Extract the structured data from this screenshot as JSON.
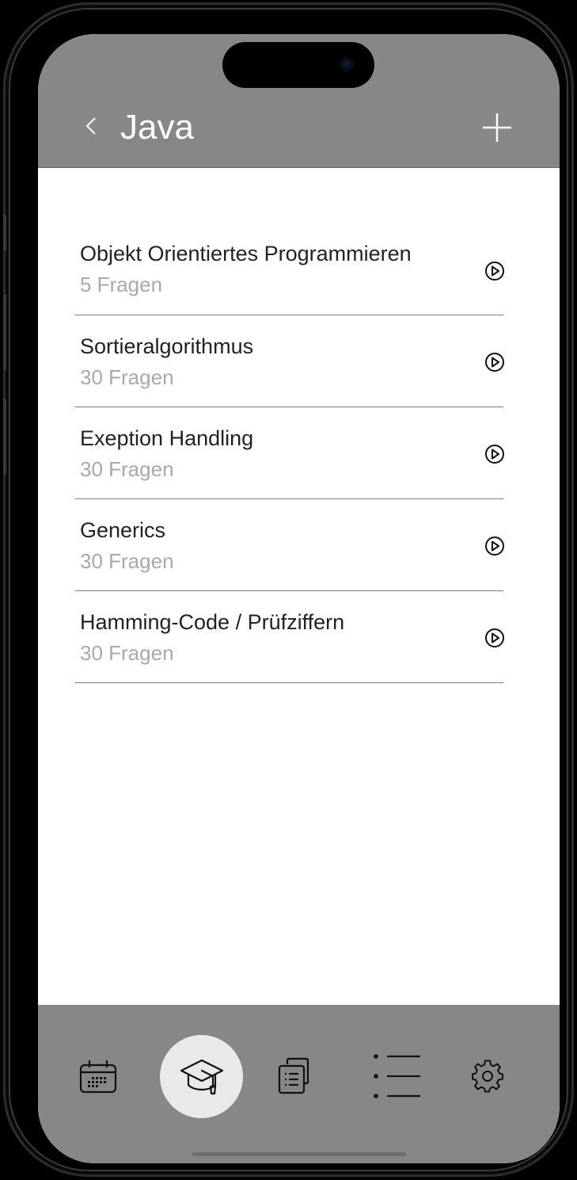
{
  "header": {
    "title": "Java",
    "back_icon": "chevron-left-icon",
    "add_icon": "plus-icon"
  },
  "topics": [
    {
      "title": "Objekt Orientiertes Programmieren",
      "subtitle": "5 Fragen"
    },
    {
      "title": "Sortieralgorithmus",
      "subtitle": "30 Fragen"
    },
    {
      "title": "Exeption Handling",
      "subtitle": "30 Fragen"
    },
    {
      "title": "Generics",
      "subtitle": "30 Fragen"
    },
    {
      "title": "Hamming-Code / Prüfziffern",
      "subtitle": "30 Fragen"
    }
  ],
  "nav": {
    "items": [
      "calendar-icon",
      "graduation-cap-icon",
      "flashcards-icon",
      "list-icon",
      "settings-icon"
    ],
    "active": "graduation-cap-icon"
  },
  "colors": {
    "header_bg": "#878787",
    "nav_bg": "#878787",
    "active_nav_bg": "#e9e9e9",
    "subtitle_text": "#a9a9a9"
  }
}
